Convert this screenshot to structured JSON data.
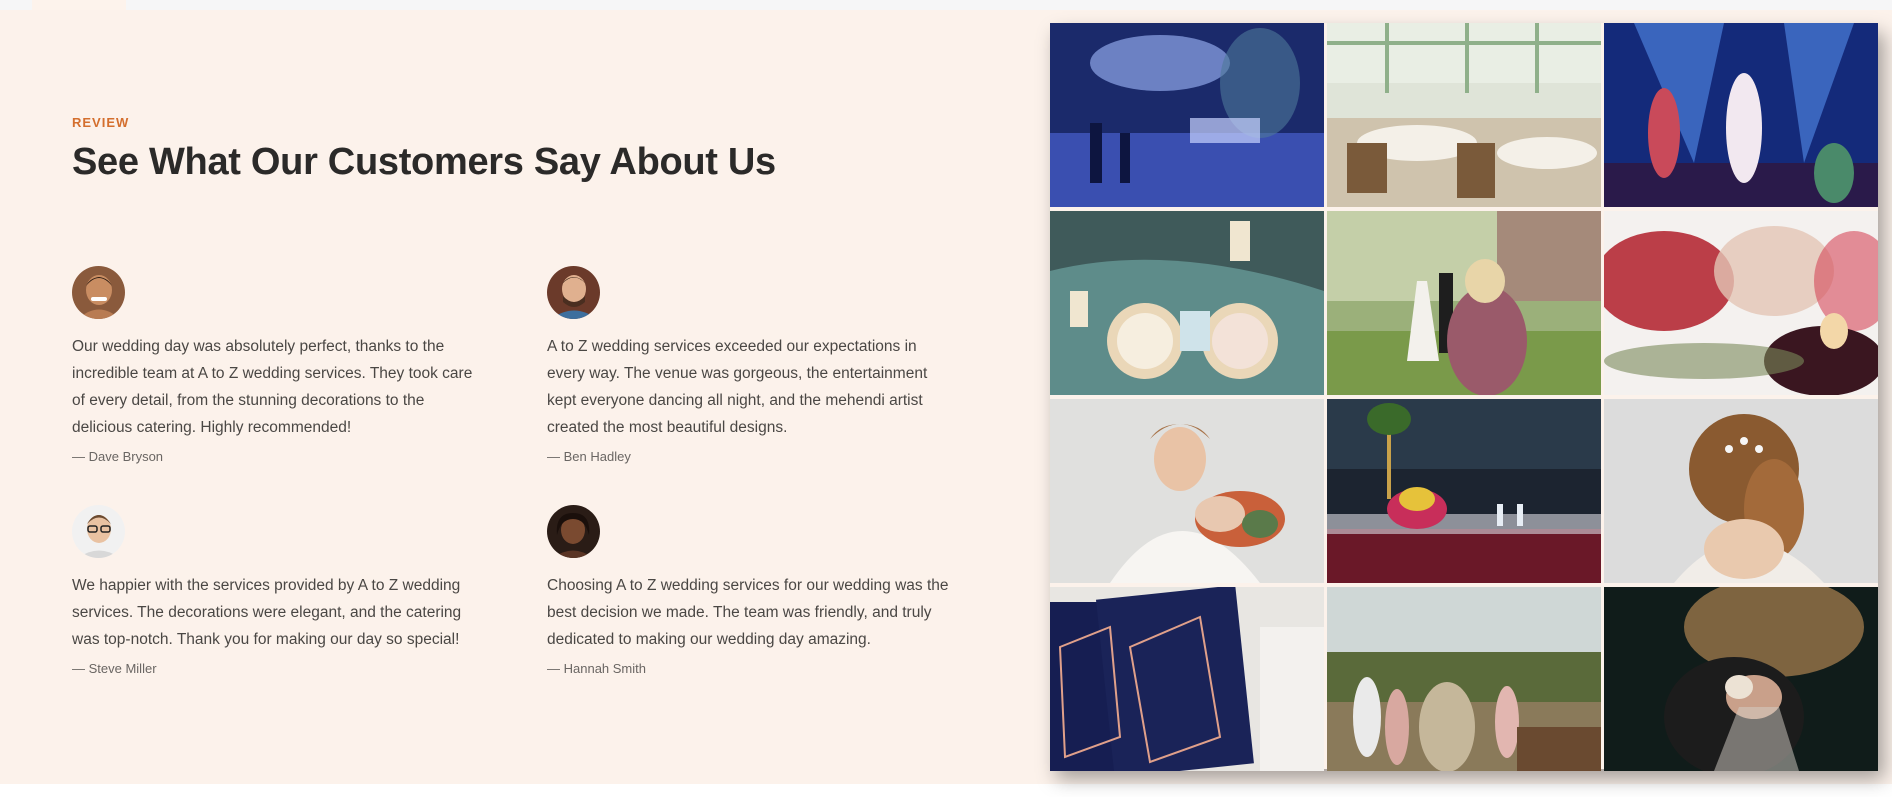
{
  "section": {
    "eyebrow": "REVIEW",
    "heading": "See What Our Customers Say About Us"
  },
  "reviews": [
    {
      "quote": "Our wedding day was absolutely perfect, thanks to the incredible team at A to Z wedding services. They took care of every detail, from the stunning decorations to the delicious catering. Highly recommended!",
      "author": "— Dave Bryson"
    },
    {
      "quote": "A to Z wedding services exceeded our expectations in every way. The venue was gorgeous, the entertainment kept everyone dancing all night, and the mehendi artist created the most beautiful designs.",
      "author": "— Ben Hadley"
    },
    {
      "quote": "We happier with the services provided by A to Z wedding services. The decorations were elegant, and the catering was top-notch. Thank you for making our day so special!",
      "author": "— Steve Miller"
    },
    {
      "quote": "Choosing A to Z wedding services for our wedding was the best decision we made. The team was friendly, and truly dedicated to making our wedding day amazing.",
      "author": "— Hannah Smith"
    }
  ],
  "gallery": {
    "photos": [
      {
        "name": "blue-lit-venue-photo"
      },
      {
        "name": "glasshouse-dining-photo"
      },
      {
        "name": "stage-dancers-photo"
      },
      {
        "name": "table-setting-photo"
      },
      {
        "name": "bride-groom-photographer-photo"
      },
      {
        "name": "blurred-toast-photo"
      },
      {
        "name": "bride-bouquet-photo"
      },
      {
        "name": "reception-table-photo"
      },
      {
        "name": "bride-hair-photo"
      },
      {
        "name": "invitation-cards-photo"
      },
      {
        "name": "outdoor-guests-photo"
      },
      {
        "name": "bride-bouquet-dark-photo"
      }
    ]
  },
  "colors": {
    "accent": "#d46f2e",
    "section_bg": "#fcf2eb",
    "heading": "#2b2a29"
  }
}
